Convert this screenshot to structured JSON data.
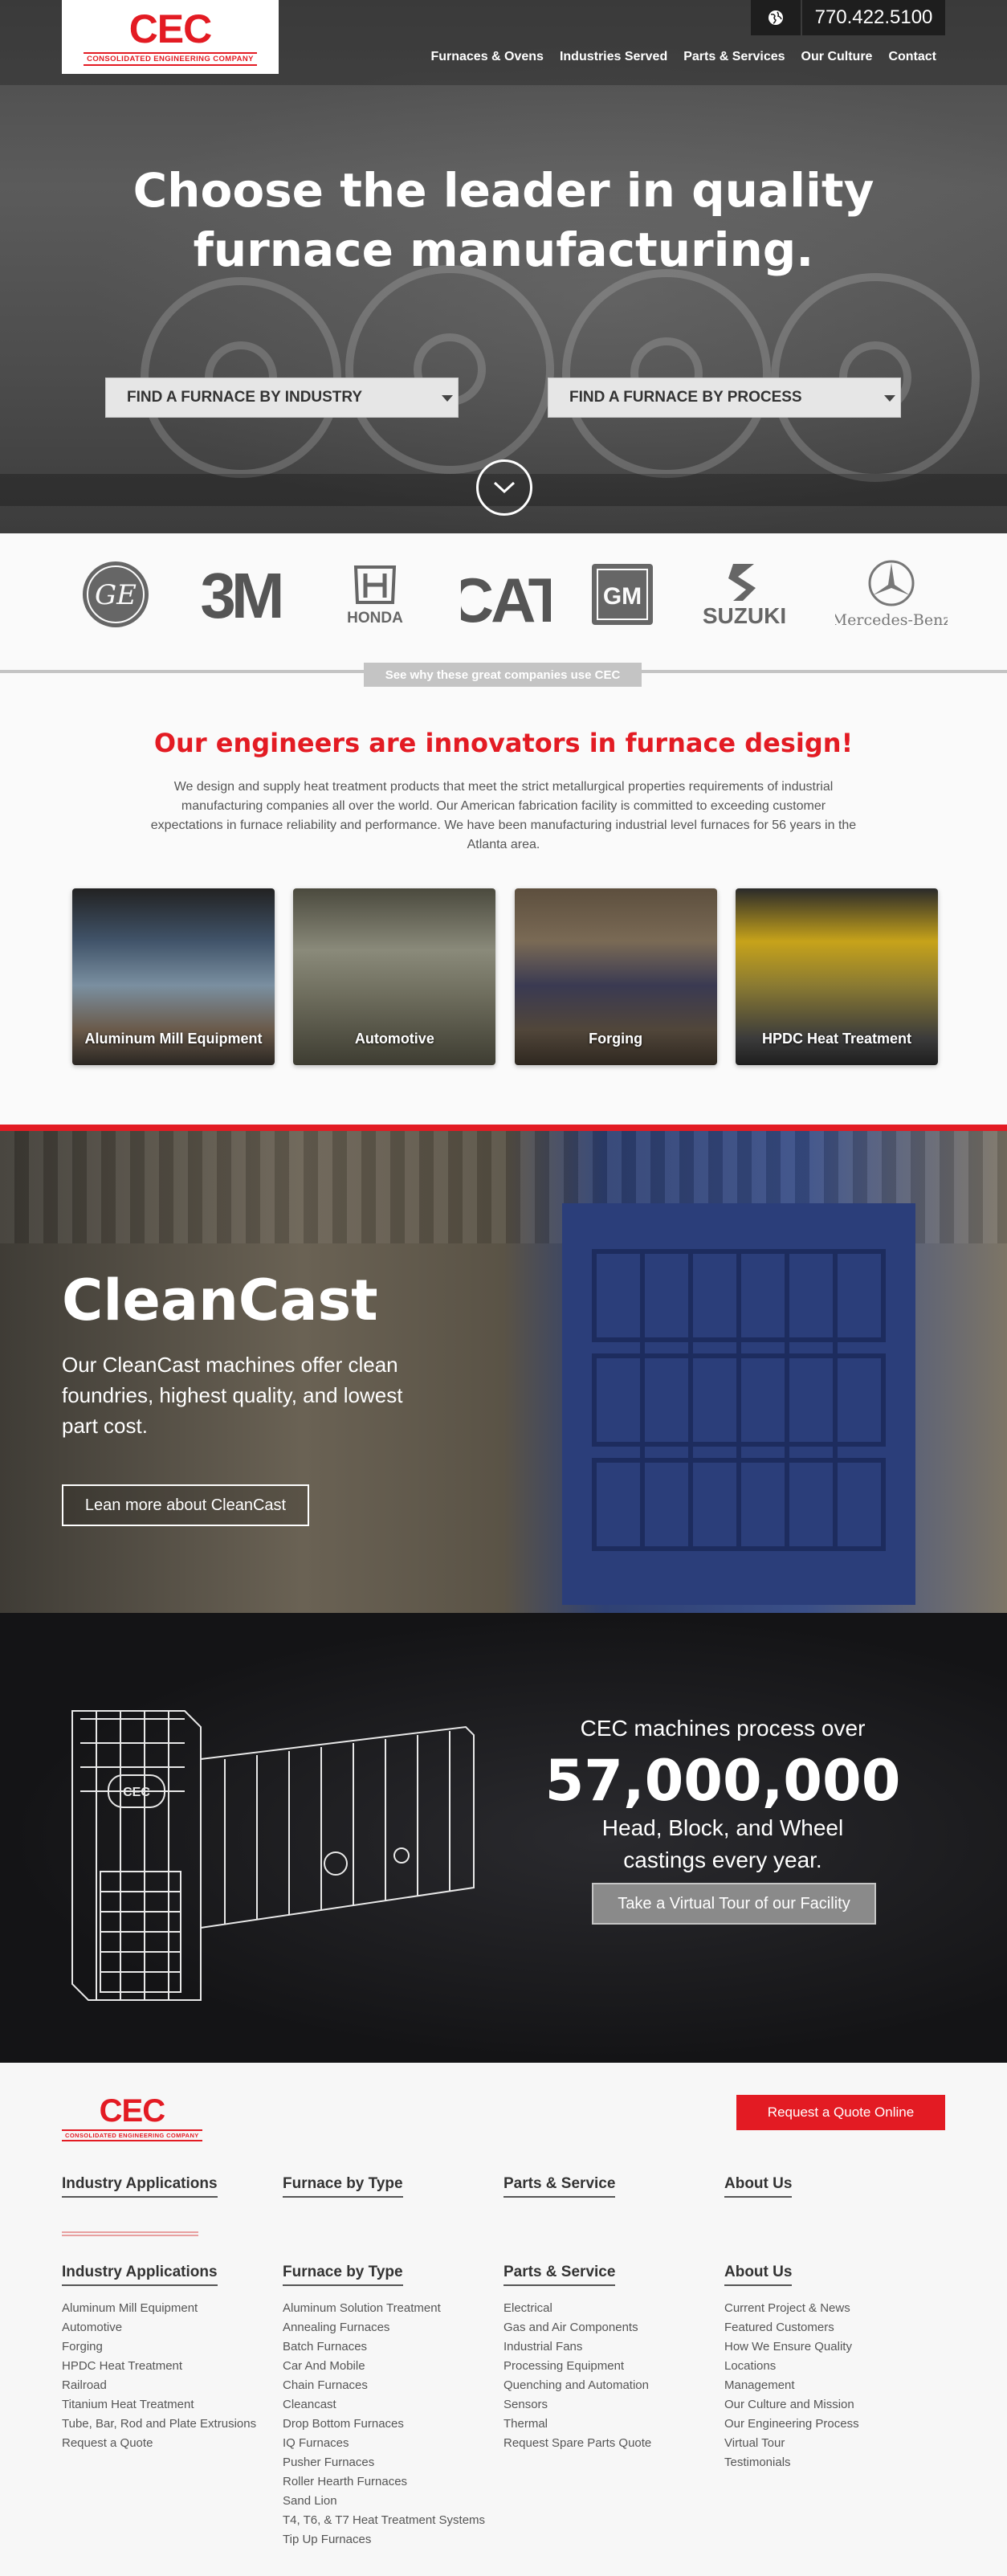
{
  "brand": {
    "letters": "CEC",
    "tagline": "CONSOLIDATED ENGINEERING COMPANY",
    "accent_color": "#e31b23"
  },
  "header": {
    "phone": "770.422.5100",
    "nav": [
      "Furnaces & Ovens",
      "Industries Served",
      "Parts & Services",
      "Our Culture",
      "Contact"
    ]
  },
  "hero": {
    "title_line1": "Choose the leader in quality",
    "title_line2": "furnace manufacturing.",
    "select_industry": "FIND A FURNACE BY INDUSTRY",
    "select_process": "FIND A FURNACE BY PROCESS"
  },
  "clients": {
    "logos": [
      "GE",
      "3M",
      "HONDA",
      "CAT",
      "GM",
      "SUZUKI",
      "Mercedes-Benz"
    ],
    "cta": "See why these great companies use CEC"
  },
  "innovators": {
    "title": "Our engineers are innovators in furnace design!",
    "text": "We design and supply heat treatment products that meet the strict metallurgical properties requirements of industrial manufacturing companies all over the world. Our American fabrication facility is committed to exceeding customer expectations in furnace reliability and performance. We have been manufacturing industrial level furnaces for 56 years in the Atlanta area.",
    "cards": [
      "Aluminum Mill Equipment",
      "Automotive",
      "Forging",
      "HPDC Heat Treatment"
    ]
  },
  "cleancast": {
    "title": "CleanCast",
    "text": "Our CleanCast machines offer clean foundries, highest quality, and lowest part cost.",
    "button": "Lean more about CleanCast"
  },
  "stats": {
    "lead": "CEC machines process over",
    "number": "57,000,000",
    "desc_line1": "Head, Block, and Wheel",
    "desc_line2": "castings every year.",
    "button": "Take a Virtual Tour of our Facility"
  },
  "footer": {
    "quote_button": "Request a Quote Online",
    "top_heads": [
      "Industry Applications",
      "Furnace by Type",
      "Parts & Service",
      "About Us"
    ],
    "columns": [
      {
        "head": "Industry Applications",
        "items": [
          "Aluminum Mill Equipment",
          "Automotive",
          "Forging",
          "HPDC Heat Treatment",
          "Railroad",
          "Titanium Heat Treatment",
          "Tube, Bar, Rod and Plate Extrusions",
          "Request a Quote"
        ]
      },
      {
        "head": "Furnace by Type",
        "items": [
          "Aluminum Solution Treatment",
          "Annealing Furnaces",
          "Batch Furnaces",
          "Car And Mobile",
          "Chain Furnaces",
          "Cleancast",
          "Drop Bottom Furnaces",
          "IQ Furnaces",
          "Pusher Furnaces",
          "Roller Hearth Furnaces",
          "Sand Lion",
          "T4, T6, & T7 Heat Treatment Systems",
          "Tip Up Furnaces"
        ]
      },
      {
        "head": "Parts & Service",
        "items": [
          "Electrical",
          "Gas and Air Components",
          "Industrial Fans",
          "Processing Equipment",
          "Quenching and Automation",
          "Sensors",
          "Thermal",
          "Request Spare Parts Quote"
        ]
      },
      {
        "head": "About Us",
        "items": [
          "Current Project & News",
          "Featured Customers",
          "How We Ensure Quality",
          "Locations",
          "Management",
          "Our Culture and Mission",
          "Our Engineering Process",
          "Virtual Tour",
          "Testimonials"
        ]
      }
    ]
  }
}
